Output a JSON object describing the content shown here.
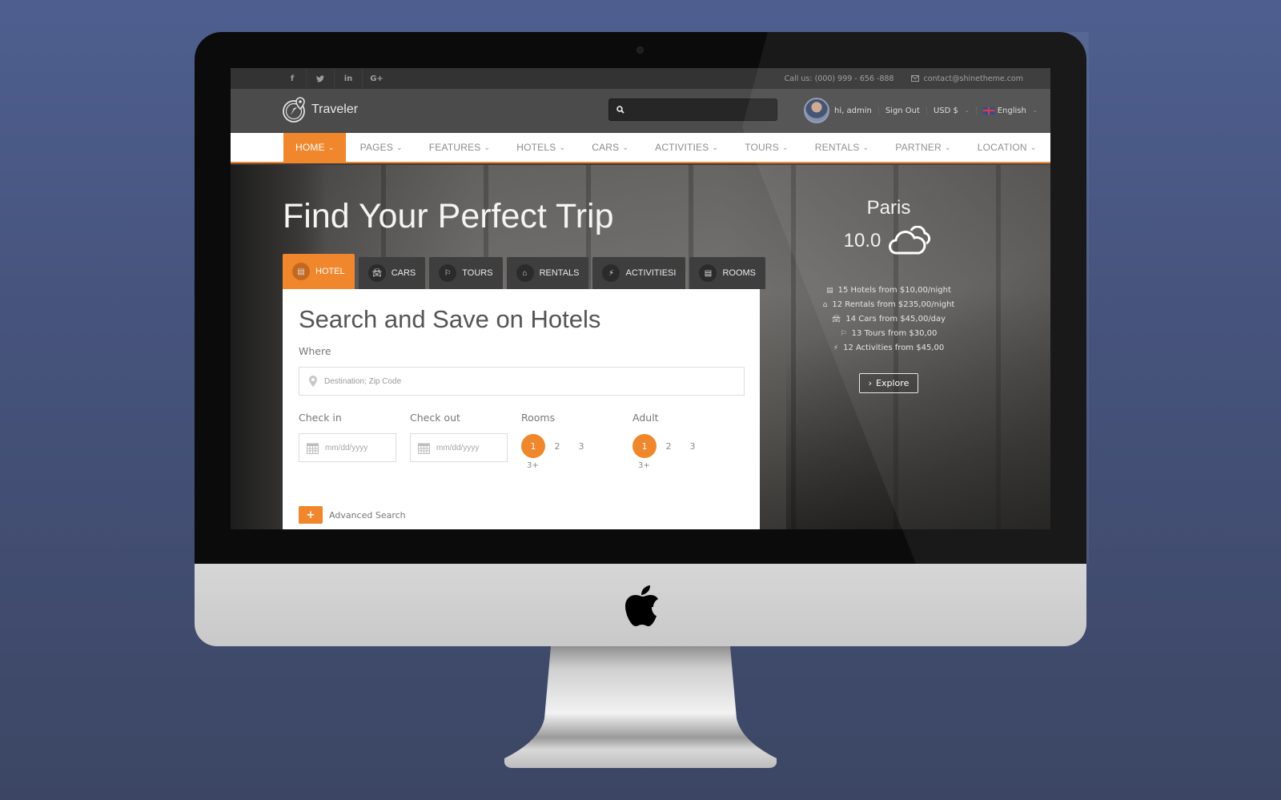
{
  "topbar": {
    "socials": [
      {
        "icon": "facebook-icon",
        "glyph": "f"
      },
      {
        "icon": "twitter-icon",
        "glyph": "🐦︎"
      },
      {
        "icon": "linkedin-icon",
        "glyph": "in"
      },
      {
        "icon": "google-plus-icon",
        "glyph": "G+"
      }
    ],
    "phone": "Call us: (000) 999 - 656 -888",
    "email": "contact@shinetheme.com"
  },
  "header": {
    "logo_text": "Traveler",
    "search_placeholder": "",
    "greeting": "hi, admin",
    "sign_out": "Sign Out",
    "currency": "USD $",
    "language": "English"
  },
  "nav": {
    "items": [
      {
        "label": "HOME",
        "active": true
      },
      {
        "label": "PAGES"
      },
      {
        "label": "FEATURES"
      },
      {
        "label": "HOTELS"
      },
      {
        "label": "CARS"
      },
      {
        "label": "ACTIVITIES"
      },
      {
        "label": "TOURS"
      },
      {
        "label": "RENTALS"
      },
      {
        "label": "PARTNER"
      },
      {
        "label": "LOCATION"
      }
    ]
  },
  "hero": {
    "title": "Find Your Perfect Trip",
    "tabs": [
      {
        "label": "HOTEL",
        "icon": "hotel-icon",
        "active": true
      },
      {
        "label": "CARS",
        "icon": "car-icon"
      },
      {
        "label": "TOURS",
        "icon": "flag-icon"
      },
      {
        "label": "RENTALS",
        "icon": "home-icon"
      },
      {
        "label": "ACTIVITIESI",
        "icon": "bolt-icon"
      },
      {
        "label": "ROOMS",
        "icon": "building-icon"
      }
    ]
  },
  "search": {
    "title": "Search and Save on Hotels",
    "where_label": "Where",
    "where_placeholder": "Destination; Zip Code",
    "checkin_label": "Check in",
    "checkin_placeholder": "mm/dd/yyyy",
    "checkout_label": "Check out",
    "checkout_placeholder": "mm/dd/yyyy",
    "rooms_label": "Rooms",
    "rooms_options": [
      "1",
      "2",
      "3"
    ],
    "rooms_more": "3+",
    "rooms_selected": "1",
    "adult_label": "Adult",
    "adult_options": [
      "1",
      "2",
      "3"
    ],
    "adult_more": "3+",
    "adult_selected": "1",
    "advanced_label": "Advanced Search"
  },
  "weather": {
    "city": "Paris",
    "temperature": "10.0",
    "condition_icon": "cloud-icon",
    "stats": [
      {
        "icon": "hotel-icon",
        "text": "15 Hotels from $10,00/night"
      },
      {
        "icon": "home-icon",
        "text": "12 Rentals from $235,00/night"
      },
      {
        "icon": "car-icon",
        "text": "14 Cars from $45,00/day"
      },
      {
        "icon": "flag-icon",
        "text": "13 Tours from $30,00"
      },
      {
        "icon": "bolt-icon",
        "text": "12 Activities from $45,00"
      }
    ],
    "explore_label": "Explore"
  },
  "colors": {
    "accent": "#f0872d",
    "header_bg": "#4b4b4b",
    "topbar_bg": "#333333",
    "backdrop": "#46537c"
  }
}
